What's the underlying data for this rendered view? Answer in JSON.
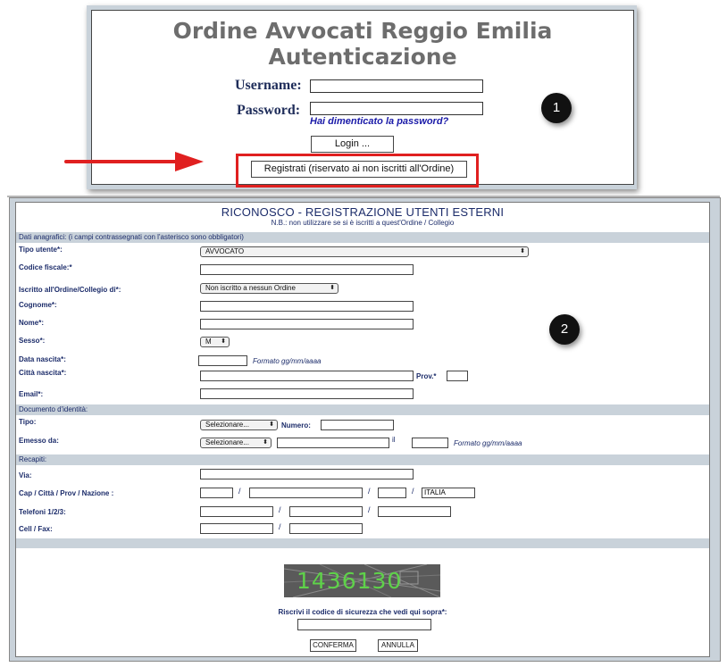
{
  "login": {
    "title_line1": "Ordine Avvocati Reggio Emilia",
    "title_line2": "Autenticazione",
    "username_label": "Username:",
    "password_label": "Password:",
    "forgot_link": "Hai dimenticato la password?",
    "login_button": "Login ...",
    "register_button": "Registrati (riservato ai non iscritti all'Ordine)"
  },
  "callouts": {
    "first": "1",
    "second": "2"
  },
  "colors": {
    "highlight": "#e02020",
    "arrow": "#e02020",
    "frame": "#c9d2da",
    "label": "#1c2c6a"
  },
  "form": {
    "title": "RICONOSCO - REGISTRAZIONE UTENTI ESTERNI",
    "subtitle": "N.B.: non utilizzare se si è iscritti a quest'Ordine / Collegio",
    "section_anagrafici": "Dati anagrafici: (i campi contrassegnati con l'asterisco sono obbligatori)",
    "tipo_utente_label": "Tipo utente*:",
    "tipo_utente_value": "AVVOCATO",
    "codice_fiscale_label": "Codice fiscale:*",
    "iscritto_label": "Iscritto all'Ordine/Collegio di*:",
    "iscritto_value": "Non iscritto a nessun Ordine",
    "cognome_label": "Cognome*:",
    "nome_label": "Nome*:",
    "sesso_label": "Sesso*:",
    "sesso_value": "M",
    "data_nascita_label": "Data nascita*:",
    "data_format_hint": "Formato gg/mm/aaaa",
    "citta_nascita_label": "Città nascita*:",
    "prov_label": "Prov.*",
    "email_label": "Email*:",
    "section_documento": "Documento d'identità:",
    "tipo_label": "Tipo:",
    "tipo_value": "Selezionare...",
    "numero_label": "Numero:",
    "emesso_label": "Emesso da:",
    "emesso_value": "Selezionare...",
    "il_label": "il",
    "emesso_date_hint": "Formato gg/mm/aaaa",
    "section_recapiti": "Recapiti:",
    "via_label": "Via:",
    "cap_label": "Cap / Città / Prov / Nazione :",
    "nazione_value": "ITALIA",
    "telefoni_label": "Telefoni 1/2/3:",
    "cell_label": "Cell / Fax:",
    "slash": "/",
    "captcha_text": "1436130",
    "captcha_prompt": "Riscrivi il codice di sicurezza che vedi qui sopra*:",
    "conferma_button": "CONFERMA",
    "annulla_button": "ANNULLA"
  }
}
